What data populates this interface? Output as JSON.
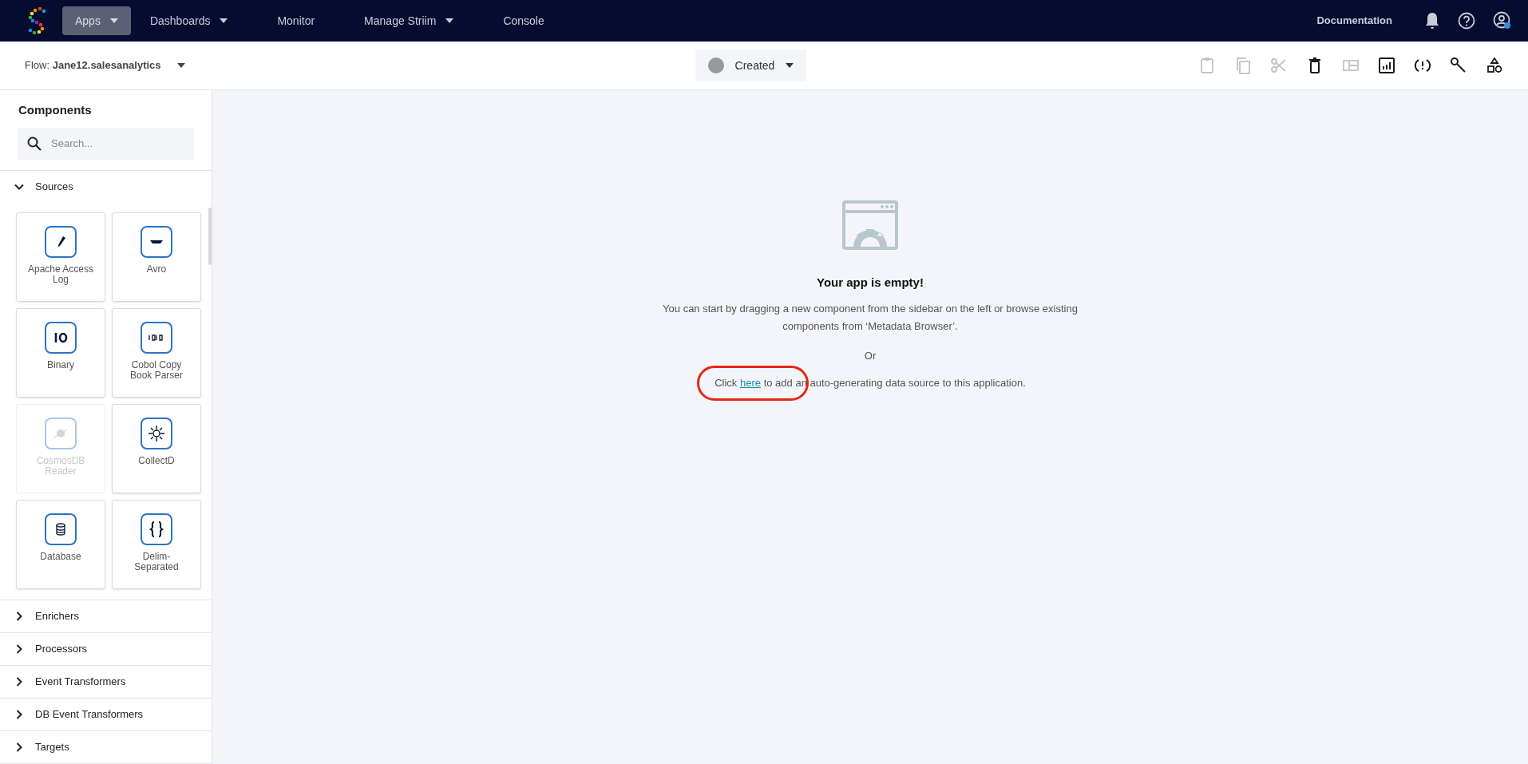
{
  "nav": {
    "items": [
      {
        "label": "Apps",
        "selected": true,
        "dropdown": true
      },
      {
        "label": "Dashboards",
        "selected": false,
        "dropdown": true
      },
      {
        "label": "Monitor",
        "selected": false,
        "dropdown": false
      },
      {
        "label": "Manage Striim",
        "selected": false,
        "dropdown": true
      },
      {
        "label": "Console",
        "selected": false,
        "dropdown": false
      }
    ],
    "documentation": "Documentation"
  },
  "toolbar": {
    "flow_label": "Flow:",
    "flow_name": "Jane12.salesanalytics",
    "status": "Created",
    "buttons": [
      {
        "disabled": true
      },
      {
        "disabled": true
      },
      {
        "disabled": true
      },
      {
        "disabled": false
      },
      {
        "disabled": true
      },
      {
        "disabled": false
      },
      {
        "disabled": false
      },
      {
        "disabled": false
      },
      {
        "disabled": false
      }
    ]
  },
  "sidebar": {
    "title": "Components",
    "search_placeholder": "Search...",
    "sections": [
      {
        "label": "Sources",
        "expanded": true,
        "tiles": [
          {
            "label": "Apache Access Log",
            "disabled": false
          },
          {
            "label": "Avro",
            "disabled": false
          },
          {
            "label": "Binary",
            "disabled": false
          },
          {
            "label": "Cobol Copy Book Parser",
            "disabled": false
          },
          {
            "label": "CosmosDB Reader",
            "disabled": true
          },
          {
            "label": "CollectD",
            "disabled": false
          },
          {
            "label": "Database",
            "disabled": false
          },
          {
            "label": "Delim-Separated",
            "disabled": false
          }
        ]
      },
      {
        "label": "Enrichers",
        "expanded": false
      },
      {
        "label": "Processors",
        "expanded": false
      },
      {
        "label": "Event Transformers",
        "expanded": false
      },
      {
        "label": "DB Event Transformers",
        "expanded": false
      },
      {
        "label": "Targets",
        "expanded": false
      }
    ]
  },
  "empty_state": {
    "title": "Your app is empty!",
    "message": "You can start by dragging a new component from the sidebar on the left or browse existing components from ‘Metadata Browser’.",
    "or": "Or",
    "click_before": "Click",
    "link": "here",
    "click_after": "to add an auto-generating data source to this application."
  }
}
